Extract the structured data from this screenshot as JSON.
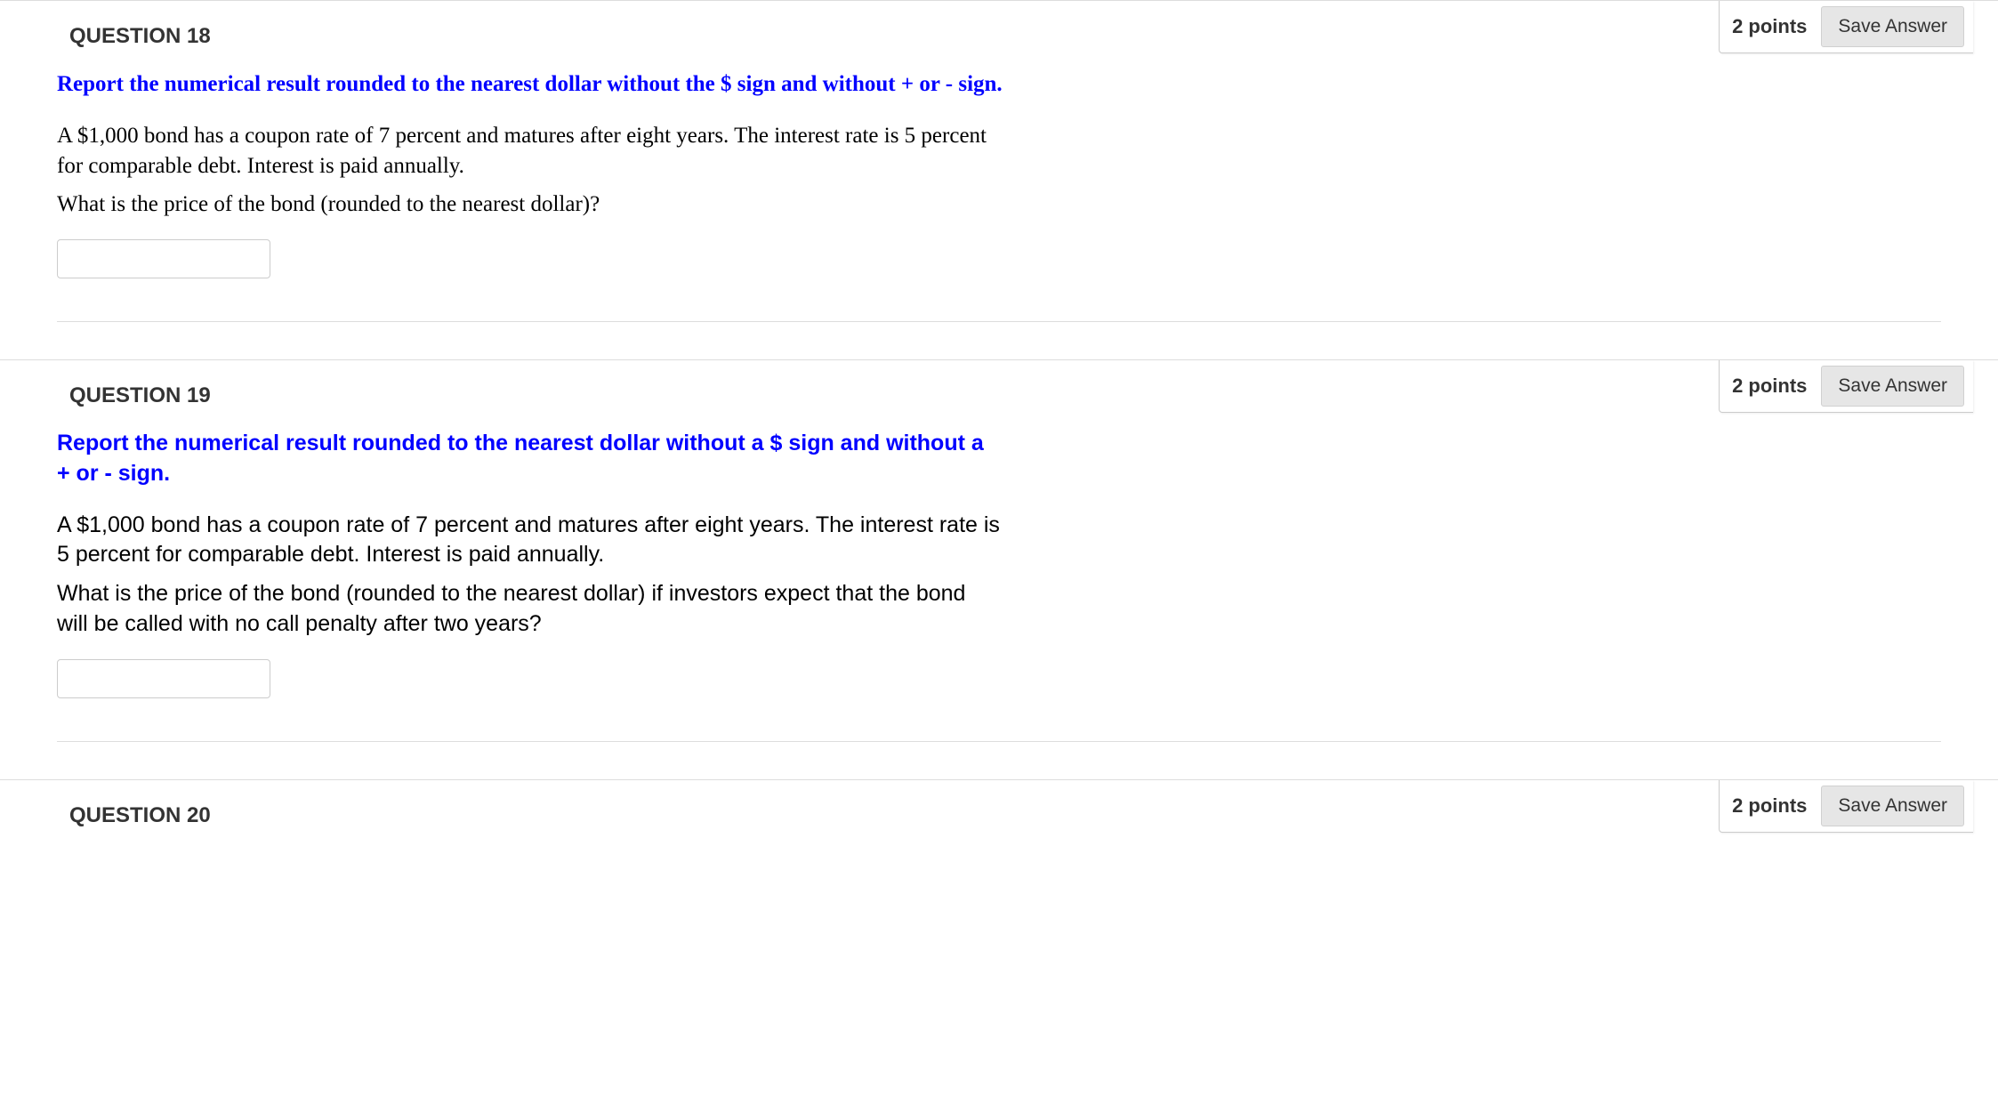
{
  "questions": [
    {
      "title": "QUESTION 18",
      "points": "2 points",
      "save_label": "Save Answer",
      "instruction": "Report the numerical result rounded to the nearest dollar without the $ sign and without + or - sign.",
      "para1": "A $1,000 bond has a coupon rate of 7 percent and matures after eight years. The interest rate is 5 percent for comparable debt. Interest is paid annually.",
      "para2": "What is the price of the bond (rounded to the nearest dollar)?",
      "answer_value": ""
    },
    {
      "title": "QUESTION 19",
      "points": "2 points",
      "save_label": "Save Answer",
      "instruction": "Report the numerical result rounded to the nearest dollar without a $ sign and without a + or - sign.",
      "para1": "A $1,000 bond has a coupon rate of 7 percent and matures after eight years. The interest rate is 5 percent for comparable debt. Interest is paid annually.",
      "para2": "What is the price of the bond (rounded to the nearest dollar) if investors expect that the bond will be called with no call penalty after two years?",
      "answer_value": ""
    },
    {
      "title": "QUESTION 20",
      "points": "2 points",
      "save_label": "Save Answer"
    }
  ]
}
